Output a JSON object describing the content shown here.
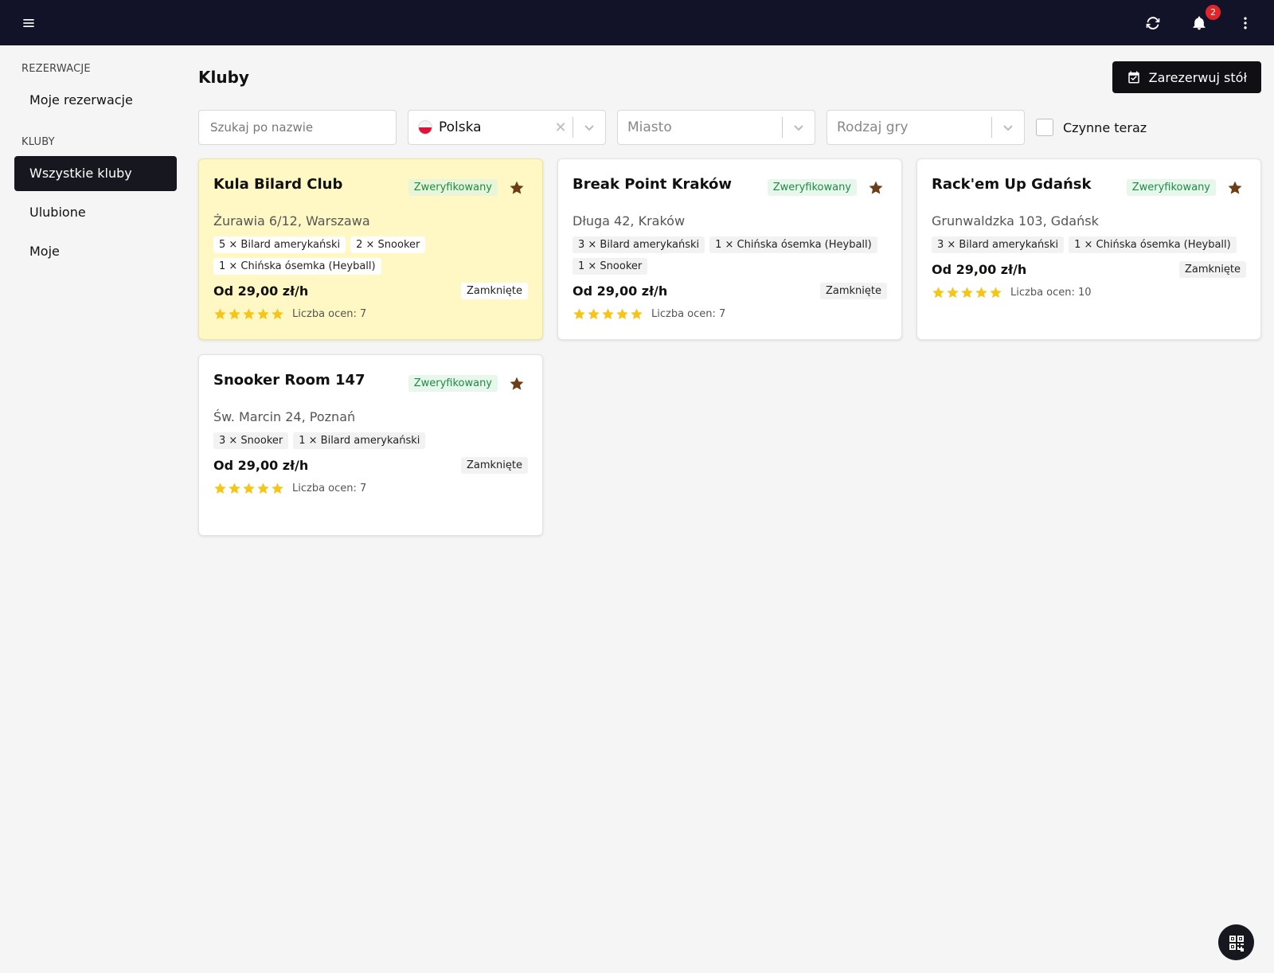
{
  "topbar": {
    "notifications_count": "2",
    "icons": [
      "menu-icon",
      "refresh-icon",
      "bell-icon",
      "more-vertical-icon"
    ]
  },
  "sidebar": {
    "section_reservations": "REZERWACJE",
    "my_reservations": "Moje rezerwacje",
    "section_clubs": "KLUBY",
    "all_clubs": "Wszystkie kluby",
    "favorites": "Ulubione",
    "mine": "Moje"
  },
  "main": {
    "title": "Kluby",
    "reserve_button": "Zarezerwuj stół",
    "filters": {
      "search_placeholder": "Szukaj po nazwie",
      "country_value": "Polska",
      "city_placeholder": "Miasto",
      "game_placeholder": "Rodzaj gry",
      "open_now_label": "Czynne teraz"
    }
  },
  "clubs": [
    {
      "name": "Kula Bilard Club",
      "verified": "Zweryfikowany",
      "address": "Żurawia 6/12, Warszawa",
      "tables": [
        "5 × Bilard amerykański",
        "2 × Snooker",
        "1 × Chińska ósemka (Heyball)"
      ],
      "price": "Od 29,00 zł/h",
      "status": "Zamknięte",
      "rating_stars": 5,
      "rating_count": "Liczba ocen: 7",
      "highlighted": true
    },
    {
      "name": "Break Point Kraków",
      "verified": "Zweryfikowany",
      "address": "Długa 42, Kraków",
      "tables": [
        "3 × Bilard amerykański",
        "1 × Chińska ósemka (Heyball)",
        "1 × Snooker"
      ],
      "price": "Od 29,00 zł/h",
      "status": "Zamknięte",
      "rating_stars": 5,
      "rating_count": "Liczba ocen: 7",
      "highlighted": false
    },
    {
      "name": "Rack'em Up Gdańsk",
      "verified": "Zweryfikowany",
      "address": "Grunwaldzka 103, Gdańsk",
      "tables": [
        "3 × Bilard amerykański",
        "1 × Chińska ósemka (Heyball)"
      ],
      "price": "Od 29,00 zł/h",
      "status": "Zamknięte",
      "rating_stars": 5,
      "rating_count": "Liczba ocen: 10",
      "highlighted": false
    },
    {
      "name": "Snooker Room 147",
      "verified": "Zweryfikowany",
      "address": "Św. Marcin 24, Poznań",
      "tables": [
        "3 × Snooker",
        "1 × Bilard amerykański"
      ],
      "price": "Od 29,00 zł/h",
      "status": "Zamknięte",
      "rating_stars": 5,
      "rating_count": "Liczba ocen: 7",
      "highlighted": false
    }
  ],
  "colors": {
    "topbar": "#121228",
    "accent_dark": "#17171f",
    "highlight_card": "#fff7c4",
    "verified_text": "#1e8a46",
    "star": "#f5c518",
    "favorite": "#6b3e17",
    "badge": "#e0262b"
  }
}
